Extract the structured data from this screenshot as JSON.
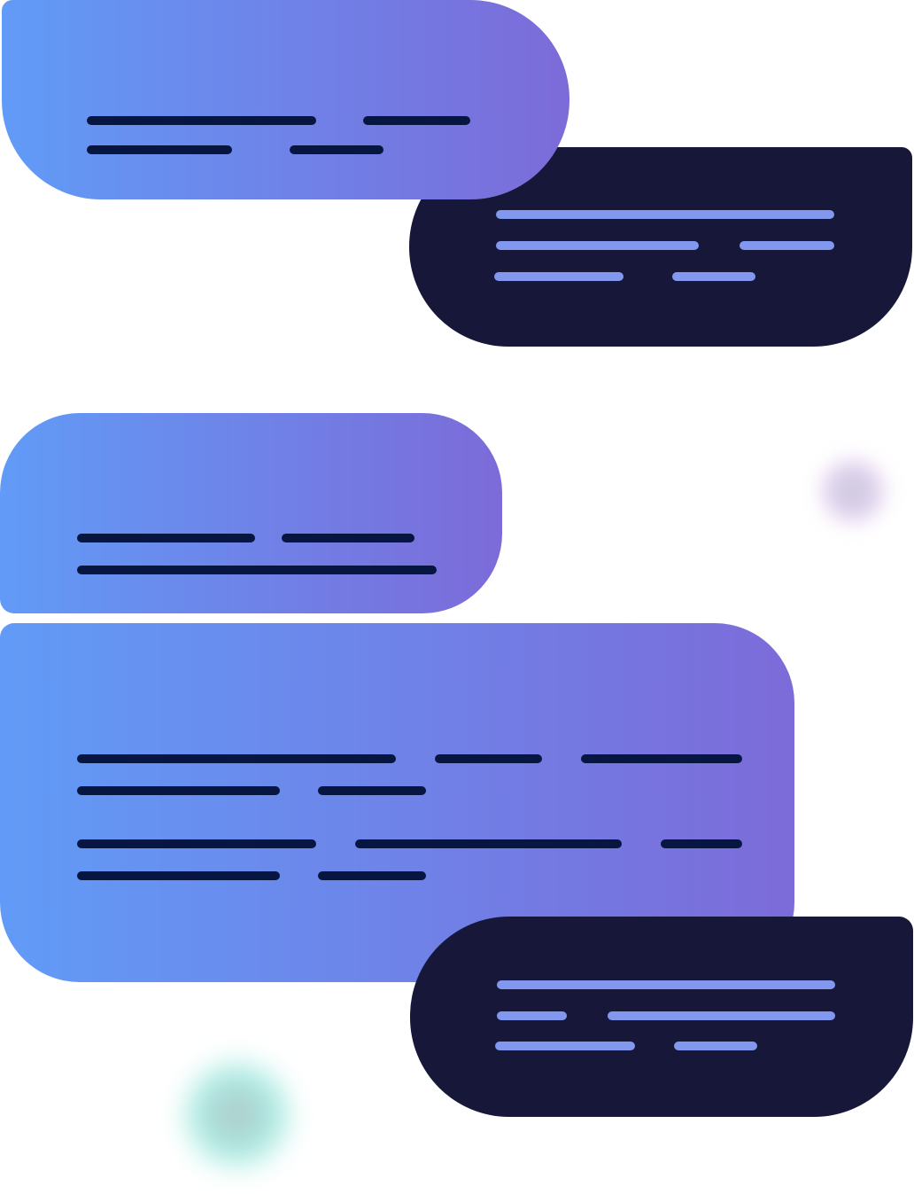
{
  "palette": {
    "gradient_start": "#619bf7",
    "gradient_end": "#7c6bd9",
    "dark_bubble": "#161739",
    "light_bubble_line": "#061641",
    "dark_bubble_line": "#8297ee",
    "pink_blob": "#dcd2ee",
    "teal_blob": "#a8e6de"
  },
  "illustration": {
    "subject": "chat-conversation",
    "bubbles": [
      {
        "style": "gradient",
        "side": "left"
      },
      {
        "style": "dark",
        "side": "right"
      },
      {
        "style": "gradient",
        "side": "left"
      },
      {
        "style": "gradient",
        "side": "left"
      },
      {
        "style": "dark",
        "side": "right"
      }
    ]
  }
}
